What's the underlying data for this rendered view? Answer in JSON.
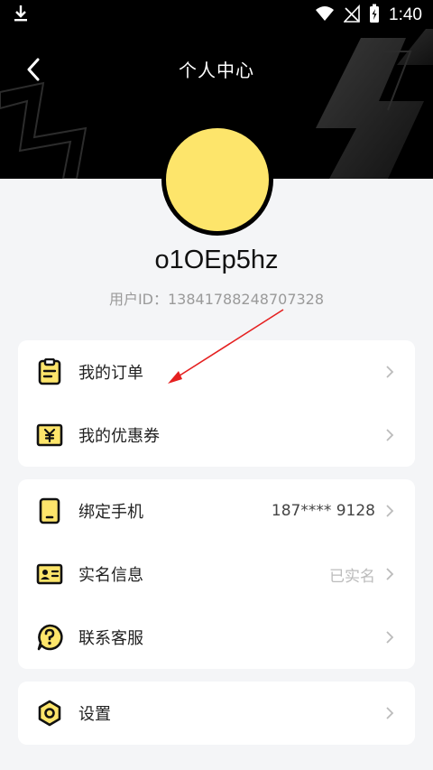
{
  "status_bar": {
    "time": "1:40"
  },
  "header": {
    "title": "个人中心"
  },
  "profile": {
    "username": "o1OEp5hz",
    "user_id": "用户ID：13841788248707328",
    "avatar_color": "#fde56b"
  },
  "menu_group_1": [
    {
      "label": "我的订单",
      "icon": "order-clipboard-icon"
    },
    {
      "label": "我的优惠券",
      "icon": "coupon-yen-icon"
    }
  ],
  "menu_group_2": [
    {
      "label": "绑定手机",
      "value": "187**** 9128",
      "icon": "phone-icon"
    },
    {
      "label": "实名信息",
      "value": "已实名",
      "icon": "id-card-icon"
    },
    {
      "label": "联系客服",
      "icon": "question-bubble-icon"
    }
  ],
  "menu_group_3": [
    {
      "label": "设置",
      "icon": "settings-hexagon-icon"
    }
  ],
  "colors": {
    "accent": "#fde56b",
    "header": "#000000",
    "annotation": "#e52020"
  }
}
